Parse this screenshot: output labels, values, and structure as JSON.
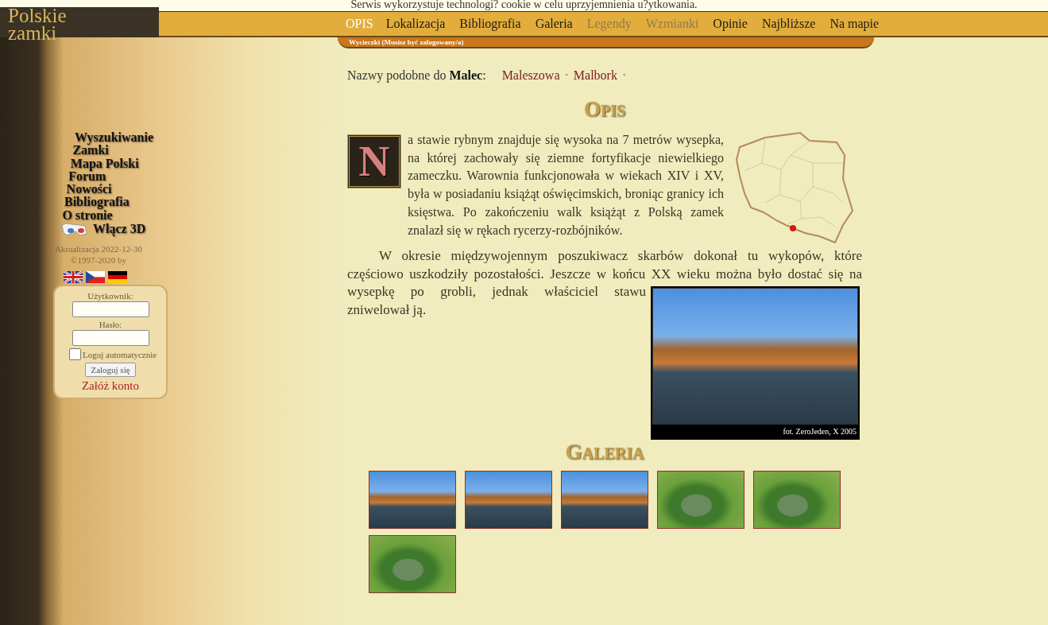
{
  "cookie_notice": "Serwis wykorzystuje technologi? cookie w celu uprzyjemnienia u?ytkowania.",
  "logo": [
    "Polskie",
    "zamki"
  ],
  "nav_tabs": [
    {
      "label": "OPIS",
      "selected": true,
      "disabled": false
    },
    {
      "label": "Lokalizacja",
      "selected": false,
      "disabled": false
    },
    {
      "label": "Bibliografia",
      "selected": false,
      "disabled": false
    },
    {
      "label": "Galeria",
      "selected": false,
      "disabled": false
    },
    {
      "label": "Legendy",
      "selected": false,
      "disabled": true
    },
    {
      "label": "Wzmianki",
      "selected": false,
      "disabled": true
    },
    {
      "label": "Opinie",
      "selected": false,
      "disabled": false
    },
    {
      "label": "Najbliższe",
      "selected": false,
      "disabled": false
    },
    {
      "label": "Na mapie",
      "selected": false,
      "disabled": false
    }
  ],
  "sub_nav": "Wycieczki (Musisz być zalogowany/a)",
  "sidebar": {
    "menu": [
      "Wyszukiwanie",
      "Zamki",
      "Mapa Polski",
      "Forum",
      "Nowości",
      "Bibliografia",
      "O stronie"
    ],
    "toggle_3d": "Włącz 3D",
    "updated": "Aktualizacja 2022-12-30",
    "copyright": "©1997-2020 by",
    "languages": [
      {
        "kind": "uk"
      },
      {
        "kind": "cz"
      },
      {
        "kind": "de"
      }
    ],
    "login": {
      "user_label": "Użytkownik:",
      "password_label": "Hasło:",
      "remember_label": "Loguj automatycznie",
      "remember_checked": false,
      "button": "Zaloguj się",
      "register": "Załóż konto"
    }
  },
  "similar_names": {
    "label": "Nazwy podobne do **Malec**:",
    "links": [
      {
        "label": "Maleszowa",
        "separator": "·"
      },
      {
        "label": "Malbork",
        "separator": "·"
      }
    ]
  },
  "description": {
    "heading": "OPIS",
    "drop_cap": "N",
    "paragraphs": [
      "a stawie rybnym znajduje się wysoka na 7 metrów wysepka, na której zachowały się ziemne fortyfikacje niewielkiego zameczku. Warownia funkcjonowała w wiekach XIV i XV, była w posiadaniu książąt oświęcimskich, broniąc granicy ich księstwa. Po zakończeniu walk książąt z Polską zamek znalazł się w rękach rycerzy-rozbójników.",
      "W okresie międzywojennym poszukiwacz skarbów dokonał tu wykopów, które częściowo uszkodziły pozostałości. Jeszcze w końcu XX wieku można było dostać się na wysepkę po grobli, jednak  właściciel stawu zniwelował ją."
    ],
    "photo_caption": "fot. ZeroJeden, X 2005"
  },
  "gallery": {
    "heading": "GALERIA",
    "photos": [
      {
        "kind": "autumn"
      },
      {
        "kind": "autumn"
      },
      {
        "kind": "autumn"
      },
      {
        "kind": "aerial"
      },
      {
        "kind": "aerial"
      },
      {
        "kind": "aerial"
      }
    ]
  }
}
